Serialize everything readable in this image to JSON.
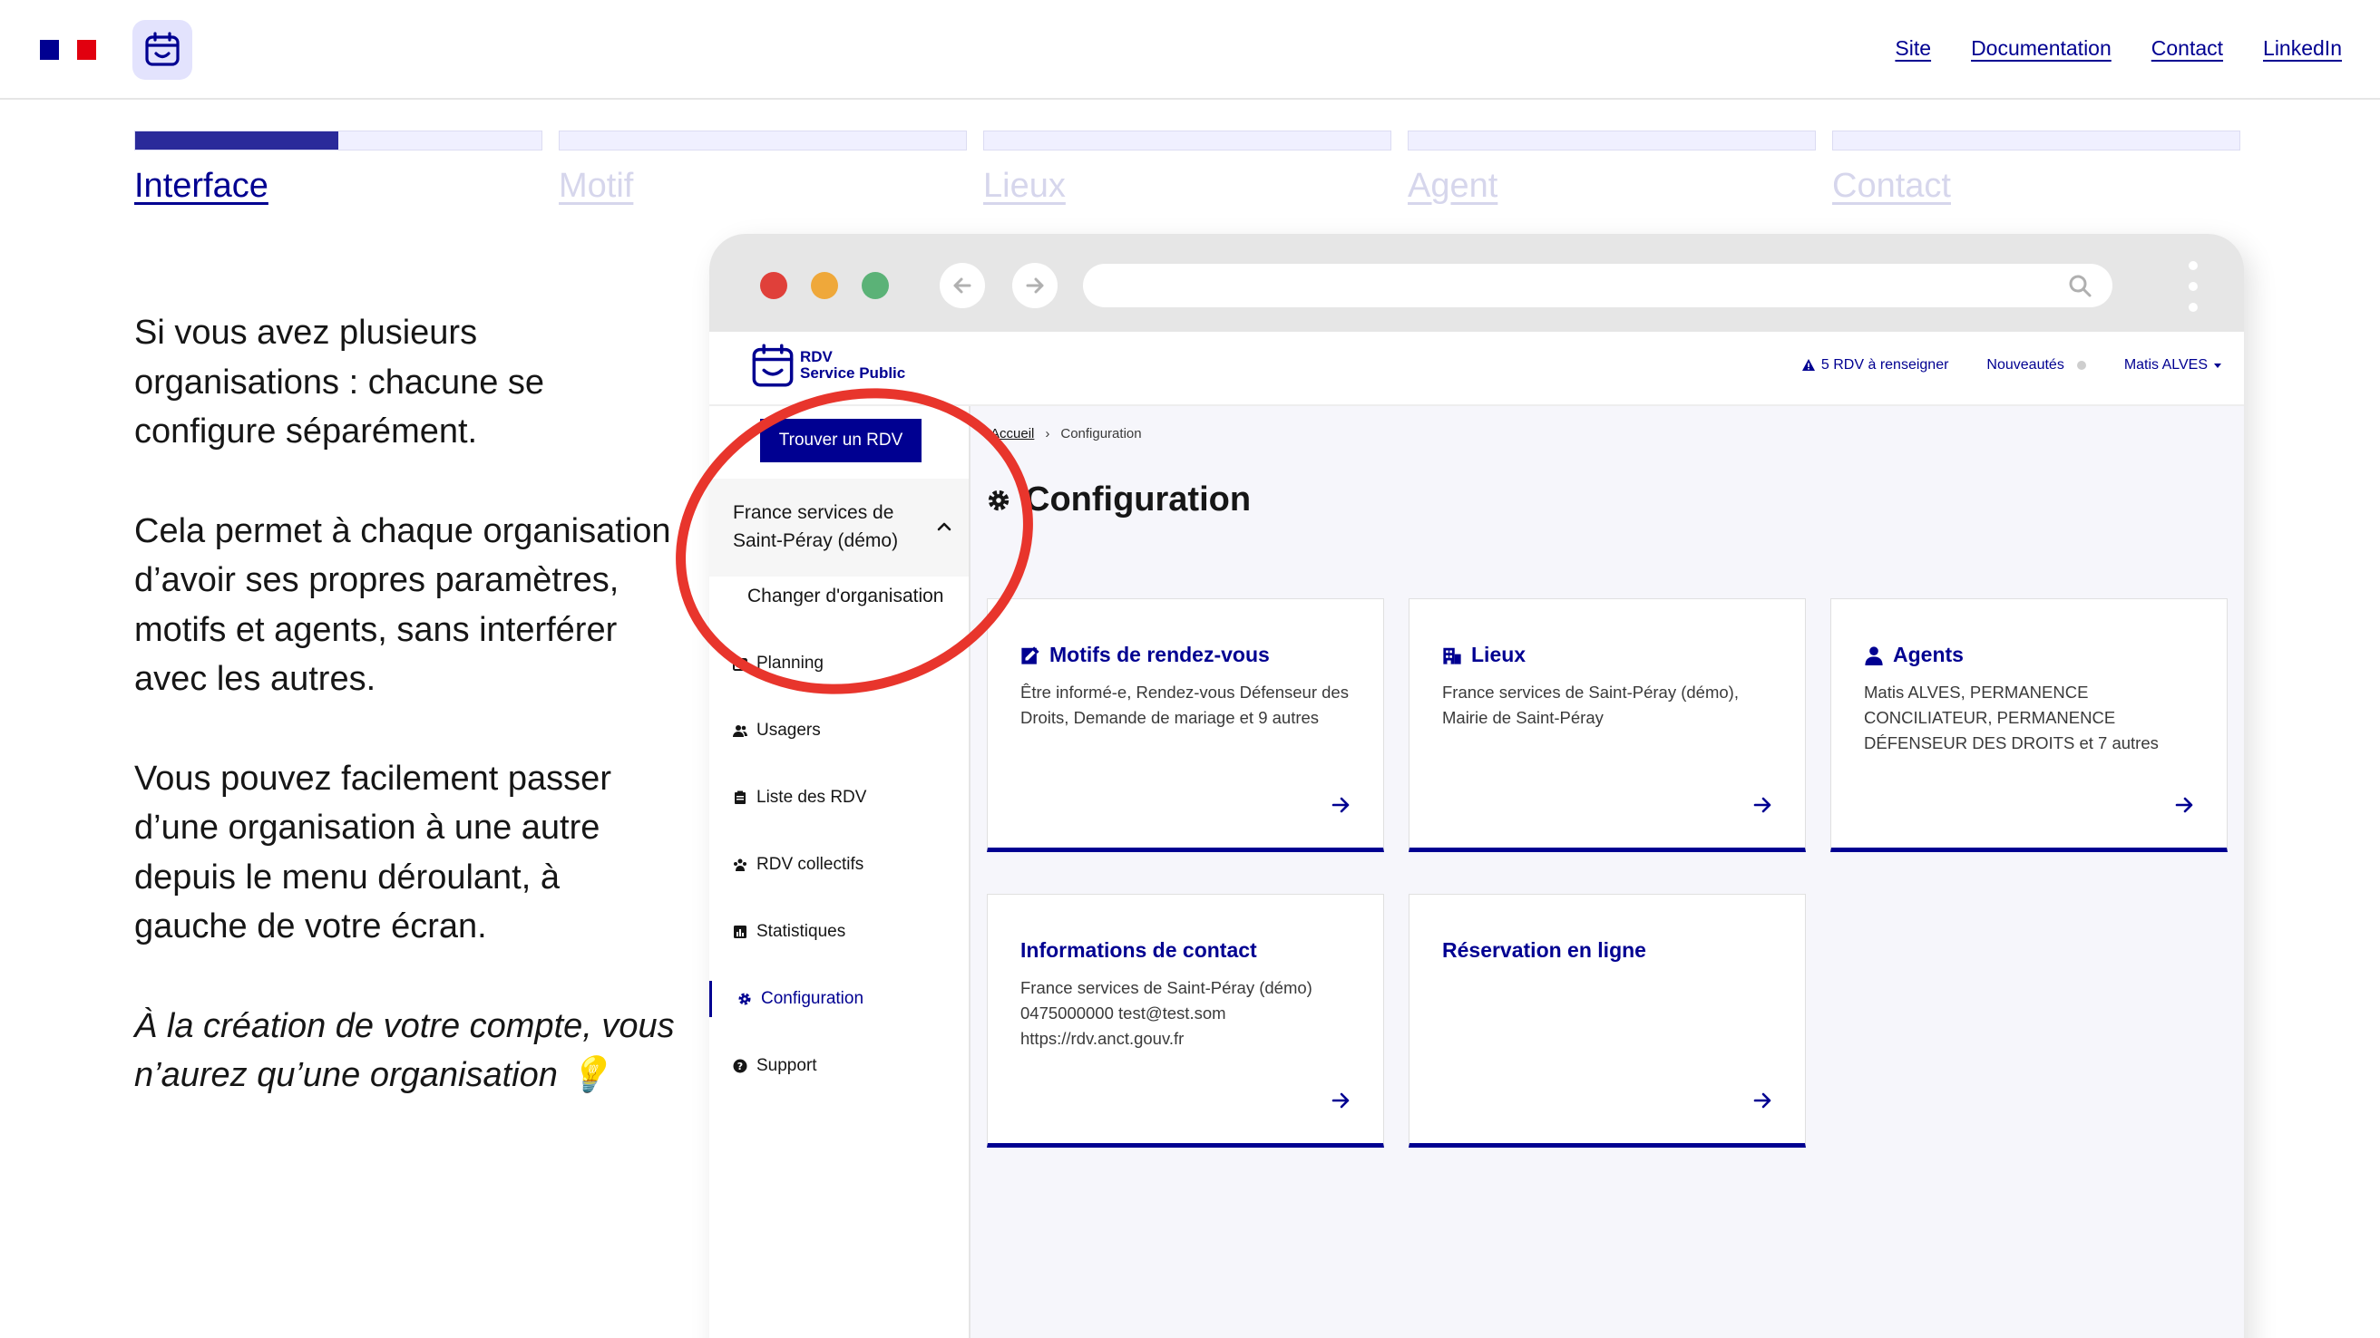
{
  "topnav": {
    "site": "Site",
    "documentation": "Documentation",
    "contact": "Contact",
    "linkedin": "LinkedIn"
  },
  "steps": [
    {
      "label": "Interface",
      "progress": 0.5
    },
    {
      "label": "Motif",
      "progress": 0
    },
    {
      "label": "Lieux",
      "progress": 0
    },
    {
      "label": "Agent",
      "progress": 0
    },
    {
      "label": "Contact",
      "progress": 0
    }
  ],
  "explanation": {
    "p1": "Si vous avez plusieurs organisations : chacune se configure séparément.",
    "p2": "Cela permet à chaque organisation d’avoir ses propres paramètres, motifs et agents, sans interférer avec les autres.",
    "p3": "Vous pouvez facilement passer d’une organisation à une autre depuis le menu déroulant, à gauche de votre écran.",
    "p4": "À la création de votre compte, vous n’aurez qu’une organisation",
    "p4_emoji": "💡"
  },
  "app": {
    "brand_line1": "RDV",
    "brand_line2": "Service Public",
    "header": {
      "alert": "5 RDV à renseigner",
      "news": "Nouveautés",
      "user": "Matis ALVES"
    },
    "sidebar": {
      "find_button": "Trouver un RDV",
      "org_name_1": "France services de",
      "org_name_2": "Saint-Péray (démo)",
      "switch_org": "Changer d'organisation",
      "items": [
        {
          "label": "Planning",
          "icon": "calendar-icon"
        },
        {
          "label": "Usagers",
          "icon": "users-icon"
        },
        {
          "label": "Liste des RDV",
          "icon": "list-icon"
        },
        {
          "label": "RDV collectifs",
          "icon": "group-icon"
        },
        {
          "label": "Statistiques",
          "icon": "chart-icon"
        },
        {
          "label": "Configuration",
          "icon": "gear-icon"
        },
        {
          "label": "Support",
          "icon": "help-icon"
        }
      ]
    },
    "breadcrumb": {
      "home": "Accueil",
      "current": "Configuration"
    },
    "title": "Configuration",
    "cards": [
      {
        "title": "Motifs de rendez-vous",
        "desc": "Être informé-e, Rendez-vous Défenseur des Droits, Demande de mariage et 9 autres"
      },
      {
        "title": "Lieux",
        "desc": "France services de Saint-Péray (démo), Mairie de Saint-Péray"
      },
      {
        "title": "Agents",
        "desc": "Matis ALVES, PERMANENCE CONCILIATEUR, PERMANENCE DÉFENSEUR DES DROITS et 7 autres"
      },
      {
        "title": "Informations de contact",
        "desc": "France services de Saint-Péray (démo) 0475000000 test@test.som https://rdv.anct.gouv.fr"
      },
      {
        "title": "Réservation en ligne",
        "desc": ""
      }
    ]
  },
  "colors": {
    "primary": "#000091",
    "highlight_ring": "#e8352c",
    "page_bg": "#f6f6fb"
  }
}
